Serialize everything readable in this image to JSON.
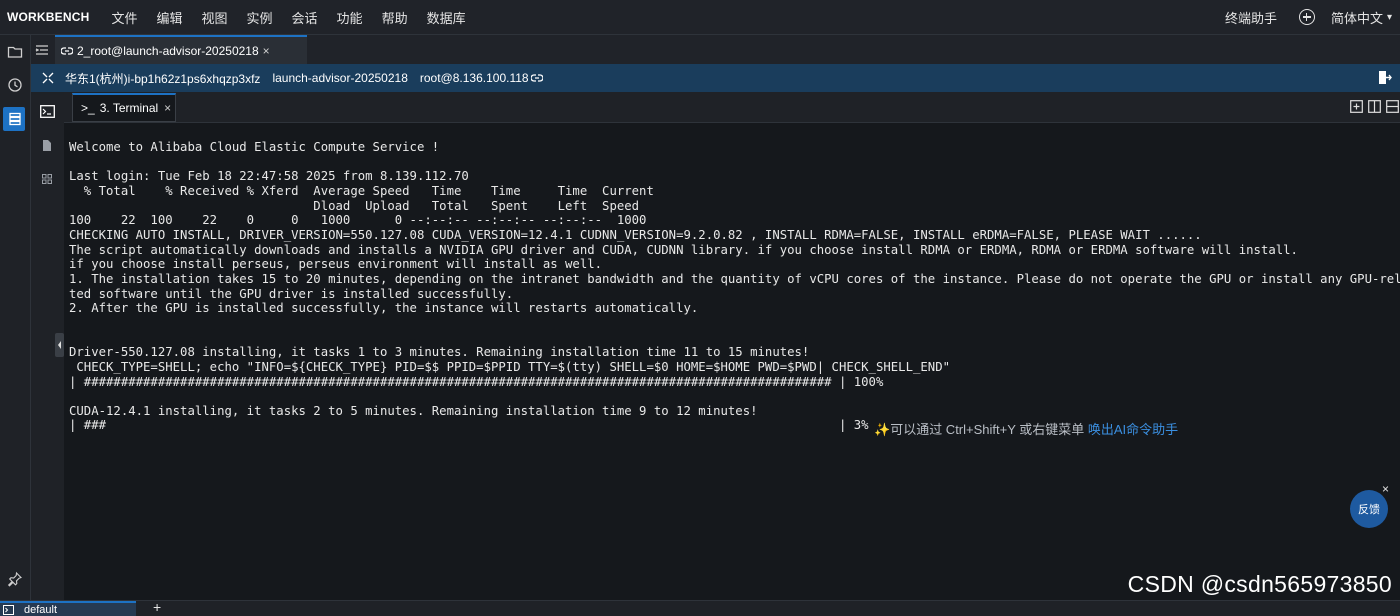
{
  "app": {
    "brand": "WORKBENCH"
  },
  "menu": [
    "文件",
    "编辑",
    "视图",
    "实例",
    "会话",
    "功能",
    "帮助",
    "数据库"
  ],
  "topbar_right": {
    "assistant": "终端助手",
    "language": "简体中文"
  },
  "session_tab": {
    "label": "2_root@launch-advisor-20250218",
    "close": "×"
  },
  "infobar": {
    "region_instance": "华东1(杭州)i-bp1h62z1ps6xhqzp3xfz",
    "hostname": "launch-advisor-20250218",
    "login": "root@8.136.100.118"
  },
  "terminal_tab": {
    "label": "3. Terminal",
    "close": "×"
  },
  "terminal": {
    "lines": [
      "Welcome to Alibaba Cloud Elastic Compute Service !",
      "",
      "Last login: Tue Feb 18 22:47:58 2025 from 8.139.112.70",
      "  % Total    % Received % Xferd  Average Speed   Time    Time     Time  Current",
      "                                 Dload  Upload   Total   Spent    Left  Speed",
      "100    22  100    22    0     0   1000      0 --:--:-- --:--:-- --:--:--  1000",
      "CHECKING AUTO INSTALL, DRIVER_VERSION=550.127.08 CUDA_VERSION=12.4.1 CUDNN_VERSION=9.2.0.82 , INSTALL RDMA=FALSE, INSTALL eRDMA=FALSE, PLEASE WAIT ......",
      "The script automatically downloads and installs a NVIDIA GPU driver and CUDA, CUDNN library. if you choose install RDMA or ERDMA, RDMA or ERDMA software will install.",
      "if you choose install perseus, perseus environment will install as well.",
      "1. The installation takes 15 to 20 minutes, depending on the intranet bandwidth and the quantity of vCPU cores of the instance. Please do not operate the GPU or install any GPU-rela",
      "ted software until the GPU driver is installed successfully.",
      "2. After the GPU is installed successfully, the instance will restarts automatically.",
      "",
      "",
      "Driver-550.127.08 installing, it tasks 1 to 3 minutes. Remaining installation time 11 to 15 minutes!",
      " CHECK_TYPE=SHELL; echo \"INFO=${CHECK_TYPE} PID=$$ PPID=$PPID TTY=$(tty) SHELL=$0 HOME=$HOME PWD=$PWD| CHECK_SHELL_END\"",
      "| ##################################################################################################### | 100%",
      "",
      "CUDA-12.4.1 installing, it tasks 2 to 5 minutes. Remaining installation time 9 to 12 minutes!",
      "| ###                                                                                                   | 3%"
    ]
  },
  "hint": {
    "spark": "✨",
    "text": "可以通过 Ctrl+Shift+Y 或右键菜单 ",
    "link": "唤出AI命令助手"
  },
  "feedback": {
    "label": "反馈",
    "close": "×"
  },
  "watermark": "CSDN @csdn565973850",
  "bottom_tab": {
    "label": "default",
    "add": "+"
  },
  "colors": {
    "accent": "#1d72c4",
    "infobar": "#1a3d5c",
    "terminal_bg": "#15181c",
    "link": "#3b8fe0"
  }
}
